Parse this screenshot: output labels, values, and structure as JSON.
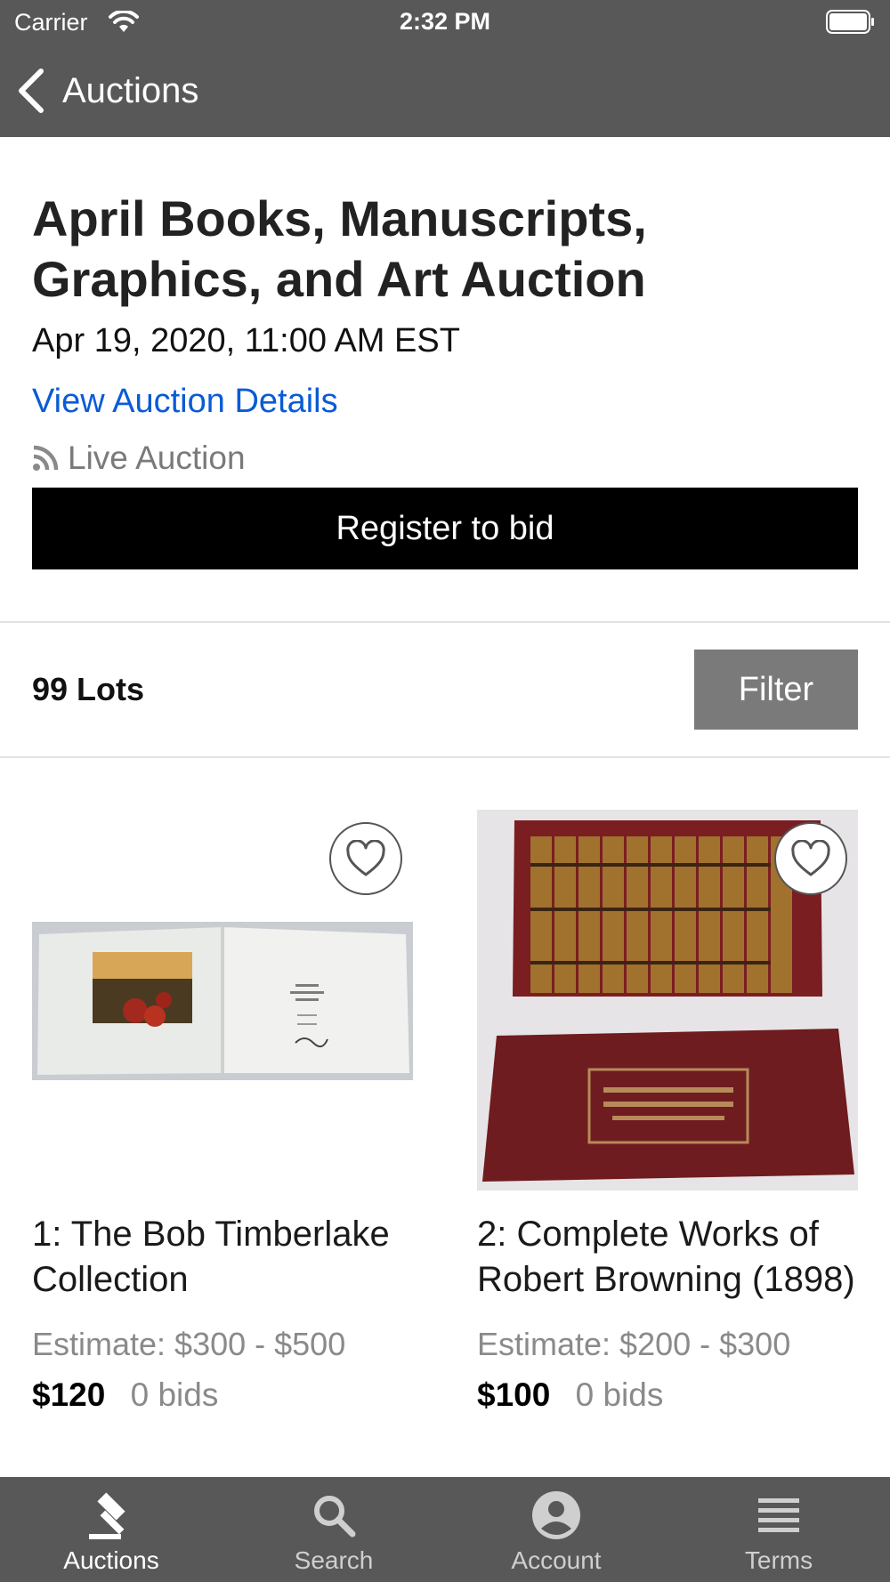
{
  "status_bar": {
    "carrier": "Carrier",
    "time": "2:32 PM"
  },
  "nav": {
    "back_label": "Auctions"
  },
  "auction": {
    "title": "April Books, Manuscripts, Graphics, and Art Auction",
    "date": "Apr 19, 2020, 11:00 AM EST",
    "details_link": "View Auction Details",
    "type_label": "Live Auction",
    "register_label": "Register to bid"
  },
  "lots_bar": {
    "count_label": "99 Lots",
    "filter_label": "Filter"
  },
  "lots": [
    {
      "title": "1: The Bob Timberlake Collection",
      "estimate": "Estimate: $300 - $500",
      "price": "$120",
      "bids": "0 bids"
    },
    {
      "title": "2: Complete Works of Robert Browning (1898)",
      "estimate": "Estimate: $200 - $300",
      "price": "$100",
      "bids": "0 bids"
    }
  ],
  "tabs": [
    {
      "label": "Auctions",
      "icon": "gavel-icon",
      "active": true
    },
    {
      "label": "Search",
      "icon": "search-icon",
      "active": false
    },
    {
      "label": "Account",
      "icon": "account-icon",
      "active": false
    },
    {
      "label": "Terms",
      "icon": "list-icon",
      "active": false
    }
  ],
  "colors": {
    "bar_background": "#585858",
    "link": "#0a5bd6",
    "register_button": "#000000",
    "filter_button": "#7a7a7a"
  }
}
